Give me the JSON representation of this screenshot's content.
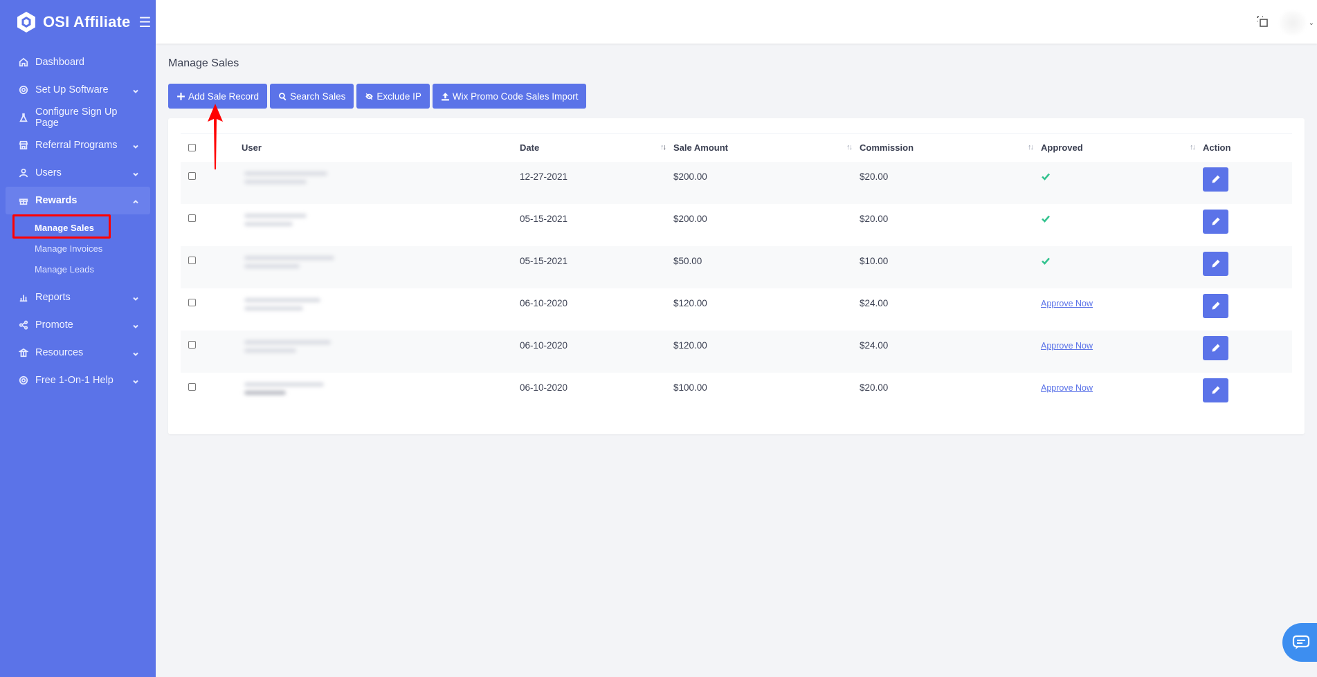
{
  "brand": {
    "name": "OSI Affiliate"
  },
  "sidebar": {
    "items": [
      {
        "label": "Dashboard",
        "icon": "home-icon"
      },
      {
        "label": "Set Up Software",
        "icon": "gear-icon"
      },
      {
        "label": "Configure Sign Up Page",
        "icon": "flask-icon"
      },
      {
        "label": "Referral Programs",
        "icon": "store-icon"
      },
      {
        "label": "Users",
        "icon": "user-icon"
      },
      {
        "label": "Rewards",
        "icon": "gift-icon"
      },
      {
        "label": "Reports",
        "icon": "bar-chart-icon"
      },
      {
        "label": "Promote",
        "icon": "share-icon"
      },
      {
        "label": "Resources",
        "icon": "bank-icon"
      },
      {
        "label": "Free 1-On-1 Help",
        "icon": "lifebuoy-icon"
      }
    ],
    "rewards_sub": [
      {
        "label": "Manage Sales"
      },
      {
        "label": "Manage Invoices"
      },
      {
        "label": "Manage Leads"
      }
    ]
  },
  "page": {
    "title": "Manage Sales"
  },
  "toolbar": {
    "add_label": "Add Sale Record",
    "search_label": "Search Sales",
    "exclude_label": "Exclude IP",
    "import_label": "Wix Promo Code Sales Import"
  },
  "table": {
    "headers": {
      "user": "User",
      "date": "Date",
      "amount": "Sale Amount",
      "commission": "Commission",
      "approved": "Approved",
      "action": "Action"
    },
    "rows": [
      {
        "date": "12-27-2021",
        "amount": "$200.00",
        "commission": "$20.00",
        "approved": true
      },
      {
        "date": "05-15-2021",
        "amount": "$200.00",
        "commission": "$20.00",
        "approved": true
      },
      {
        "date": "05-15-2021",
        "amount": "$50.00",
        "commission": "$10.00",
        "approved": true
      },
      {
        "date": "06-10-2020",
        "amount": "$120.00",
        "commission": "$24.00",
        "approved": false,
        "approve_label": "Approve Now"
      },
      {
        "date": "06-10-2020",
        "amount": "$120.00",
        "commission": "$24.00",
        "approved": false,
        "approve_label": "Approve Now"
      },
      {
        "date": "06-10-2020",
        "amount": "$100.00",
        "commission": "$20.00",
        "approved": false,
        "approve_label": "Approve Now"
      }
    ]
  },
  "colors": {
    "primary": "#5b73e8",
    "success": "#34c38f",
    "annotation": "#ff0000",
    "chat": "#3d8ef0"
  }
}
